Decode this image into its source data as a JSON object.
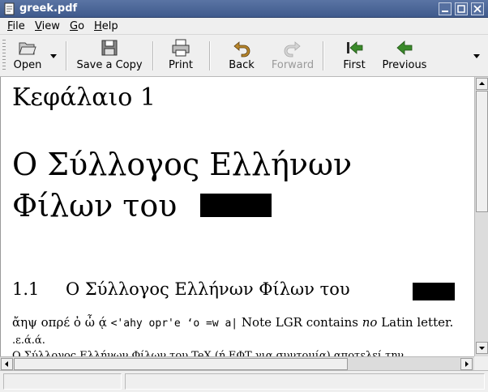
{
  "window": {
    "title": "greek.pdf"
  },
  "menubar": {
    "items": [
      {
        "label": "File",
        "mnemonic": "F",
        "rest": "ile"
      },
      {
        "label": "View",
        "mnemonic": "V",
        "rest": "iew"
      },
      {
        "label": "Go",
        "mnemonic": "G",
        "rest": "o"
      },
      {
        "label": "Help",
        "mnemonic": "H",
        "rest": "elp"
      }
    ]
  },
  "toolbar": {
    "open_label": "Open",
    "save_label": "Save a Copy",
    "print_label": "Print",
    "back_label": "Back",
    "forward_label": "Forward",
    "first_label": "First",
    "previous_label": "Previous"
  },
  "document": {
    "chapter_heading": "Κεφάλαιο 1",
    "title_line1": "Ο Σύλλογος Ελλήνων",
    "title_line2": "Φίλων του",
    "section_number": "1.1",
    "section_title": "Ο Σύλλογος Ελλήνων Φίλων του",
    "line1_greek": "ἄηψ οπρέ ὀ ὦ ᾴ ",
    "line1_mono": "<'ahy opr'e ‘o =w a|",
    "line1_text_a": " Note LGR contains ",
    "line1_text_italic": "no",
    "line1_text_b": " Latin letter.",
    "line2": ".ε.ά.ά.",
    "line3": "Ο Σύλλογος Ελλήνων Φίλων του TeX (ή ΕΦΤ για συντομία) αποτελεί την"
  },
  "icons": {
    "open": "folder-open-icon",
    "save": "floppy-save-icon",
    "print": "printer-icon",
    "back": "undo-back-icon",
    "forward": "redo-forward-icon",
    "first": "go-first-icon",
    "previous": "go-previous-icon"
  },
  "colors": {
    "titlebar": "#4a6494",
    "toolbar_bg": "#efefef",
    "arrow_green": "#3a8a2a",
    "redaction": "#000000"
  }
}
